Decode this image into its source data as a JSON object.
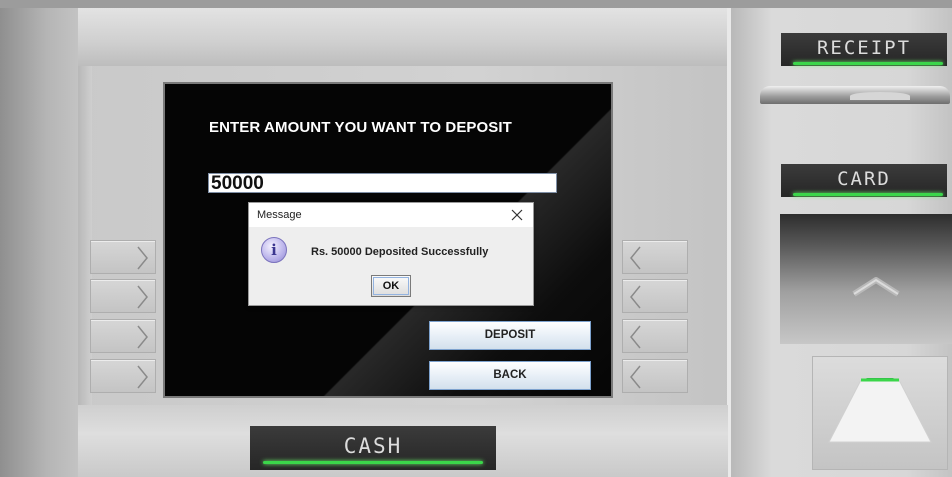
{
  "screen": {
    "prompt": "ENTER AMOUNT YOU WANT TO DEPOSIT",
    "amount_value": "50000",
    "deposit_label": "DEPOSIT",
    "back_label": "BACK"
  },
  "dialog": {
    "title": "Message",
    "close_glyph": "✕",
    "message": "Rs. 50000 Deposited Successfully",
    "ok_label": "OK",
    "icon": "info-icon"
  },
  "hardware": {
    "receipt_label": "RECEIPT",
    "card_label": "CARD",
    "cash_label": "CASH",
    "indicator_color": "#3bd64a"
  },
  "icons": {
    "left_keys": "chevron-right-icon",
    "right_keys": "chevron-left-icon",
    "card_slot": "chevron-up-icon",
    "info_glyph": "i"
  }
}
